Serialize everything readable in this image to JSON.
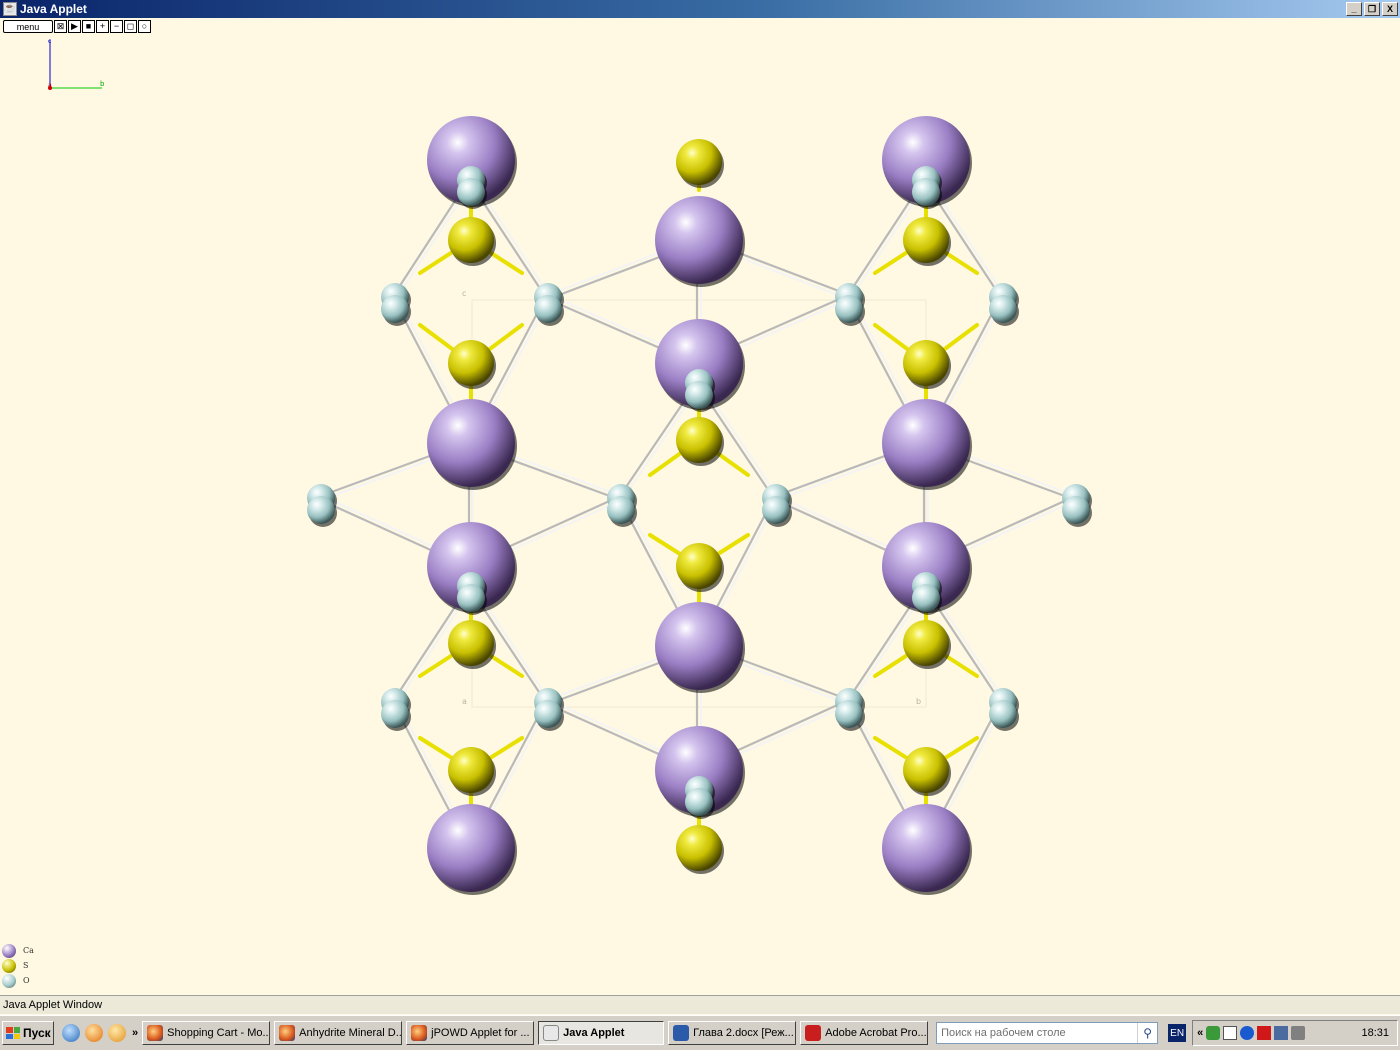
{
  "window": {
    "title": "Java Applet",
    "buttons": [
      "_",
      "❐",
      "X"
    ]
  },
  "applet_toolbar": {
    "menu_label": "menu",
    "buttons": [
      "⊠",
      "▶",
      "■",
      "+",
      "−",
      "◻",
      "○"
    ]
  },
  "axes": {
    "labels": {
      "a": "a",
      "b": "b",
      "c": "c"
    },
    "colors": {
      "a": "#cc0000",
      "b": "#00cc00",
      "c": "#0000cc"
    }
  },
  "cell_labels": {
    "c": "c",
    "a": "a",
    "b": "b"
  },
  "legend": [
    {
      "element": "Ca",
      "color": "#9a7ec4"
    },
    {
      "element": "S",
      "color": "#c8c000"
    },
    {
      "element": "O",
      "color": "#a6cccc"
    }
  ],
  "status_bar": {
    "text": "Java Applet Window"
  },
  "taskbar": {
    "start_label": "Пуск",
    "quick_launch": [
      "network-icon",
      "media-icon",
      "messenger-icon"
    ],
    "more_chevron": "»",
    "tasks": [
      {
        "label": "Shopping Cart - Mo...",
        "icon": "firefox-icon",
        "active": false
      },
      {
        "label": "Anhydrite Mineral D...",
        "icon": "firefox-icon",
        "active": false
      },
      {
        "label": "jPOWD Applet for ...",
        "icon": "firefox-icon",
        "active": false
      },
      {
        "label": "Java Applet",
        "icon": "java-icon",
        "active": true
      },
      {
        "label": "Глава 2.docx [Реж...",
        "icon": "word-icon",
        "active": false
      },
      {
        "label": "Adobe Acrobat Pro...",
        "icon": "acrobat-icon",
        "active": false
      }
    ],
    "search_placeholder": "Поиск на рабочем столе",
    "language": "EN",
    "tray_chevron": "«",
    "clock": "18:31"
  },
  "colors": {
    "background": "#fff8e2",
    "calcium": "#9a7ec4",
    "sulfur": "#c8c000",
    "oxygen": "#a6cccc",
    "bond_white": "#eeeeee",
    "bond_yellow": "#e8e000"
  }
}
